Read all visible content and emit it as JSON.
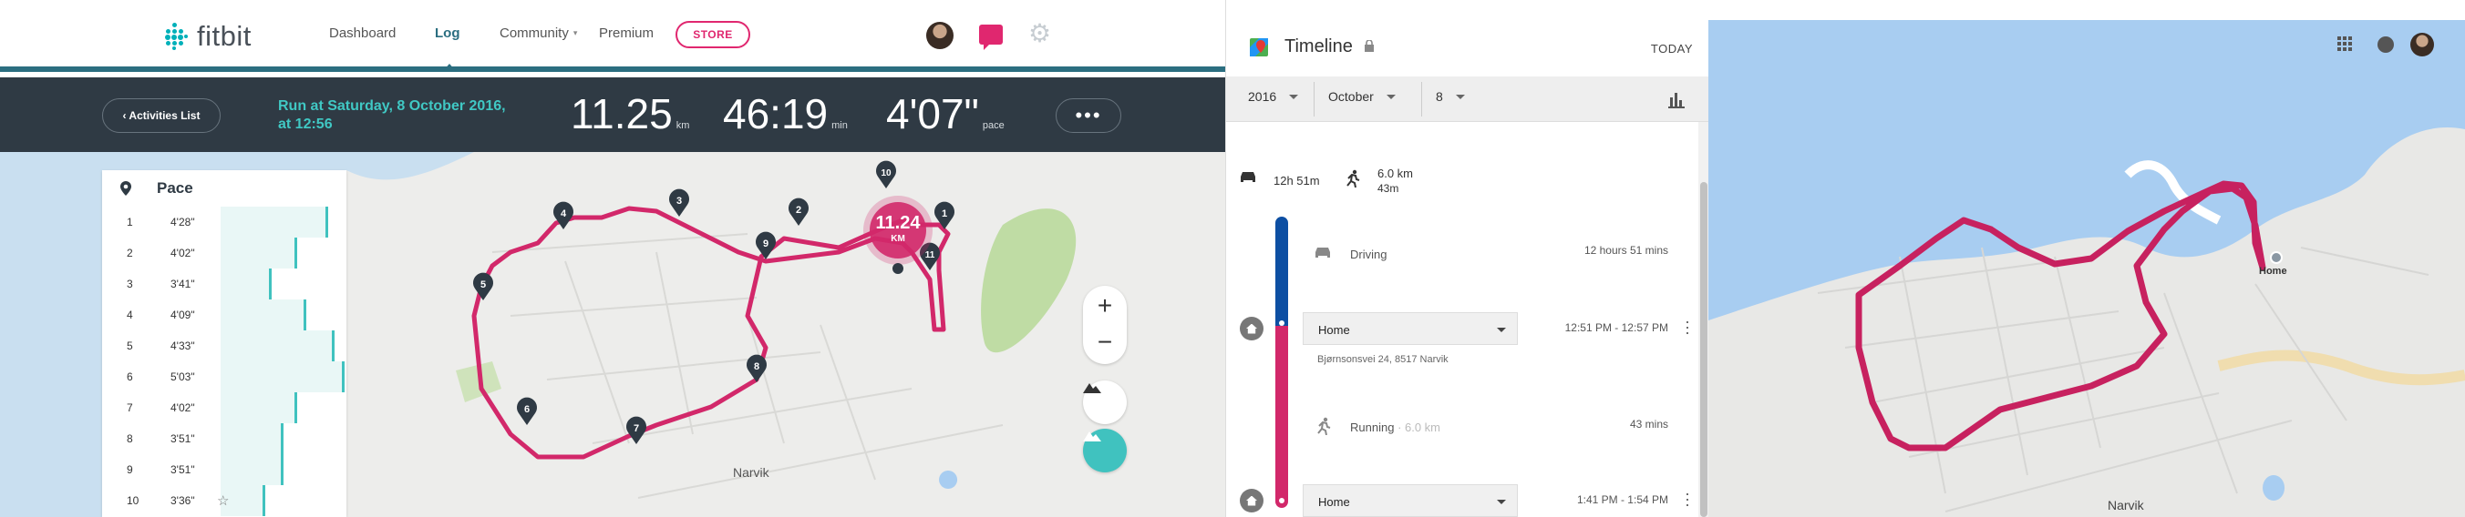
{
  "fitbit": {
    "logo": "fitbit",
    "nav": [
      "Dashboard",
      "Log",
      "Community",
      "Premium"
    ],
    "store": "STORE",
    "back": "‹ Activities List",
    "run_title": "Run at Saturday, 8 October 2016, at 12:56",
    "distance": {
      "value": "11.25",
      "unit": "km"
    },
    "duration": {
      "value": "46:19",
      "unit": "min"
    },
    "pace": {
      "value": "4'07\"",
      "unit": "pace"
    },
    "more": "•••",
    "map_badge": {
      "value": "11.24",
      "unit": "KM"
    },
    "town": "Narvik",
    "markers": [
      "1",
      "3",
      "4",
      "5",
      "6",
      "7",
      "8",
      "9",
      "10",
      "11",
      "2"
    ],
    "zoom_in": "+",
    "zoom_out": "−",
    "pace_panel": {
      "title": "Pace",
      "rows": [
        {
          "n": "1",
          "v": "4'28\"",
          "frac": 0.87
        },
        {
          "n": "2",
          "v": "4'02\"",
          "frac": 0.62
        },
        {
          "n": "3",
          "v": "3'41\"",
          "frac": 0.41
        },
        {
          "n": "4",
          "v": "4'09\"",
          "frac": 0.69
        },
        {
          "n": "5",
          "v": "4'33\"",
          "frac": 0.92
        },
        {
          "n": "6",
          "v": "5'03\"",
          "frac": 1.0
        },
        {
          "n": "7",
          "v": "4'02\"",
          "frac": 0.62
        },
        {
          "n": "8",
          "v": "3'51\"",
          "frac": 0.51
        },
        {
          "n": "9",
          "v": "3'51\"",
          "frac": 0.51
        },
        {
          "n": "10",
          "v": "3'36\"",
          "frac": 0.36
        }
      ]
    }
  },
  "timeline": {
    "title": "Timeline",
    "today": "TODAY",
    "year": "2016",
    "month": "October",
    "day": "8",
    "summary": {
      "drive": "12h 51m",
      "walk_km": "6.0 km",
      "walk_time": "43m"
    },
    "driving": {
      "label": "Driving",
      "time": "12 hours 51 mins"
    },
    "home1": {
      "label": "Home",
      "time": "12:51 PM - 12:57 PM",
      "address": "Bjørnsonsvei 24, 8517 Narvik"
    },
    "running": {
      "label": "Running",
      "dist": "· 6.0 km",
      "time": "43 mins"
    },
    "home2": {
      "label": "Home",
      "time": "1:41 PM - 1:54 PM"
    }
  },
  "gmap": {
    "home": "Home",
    "town": "Narvik"
  },
  "colors": {
    "route": "#d2286a",
    "teal": "#40c2bf",
    "bar": "#2f3a44",
    "water": "#a8cdf1"
  }
}
